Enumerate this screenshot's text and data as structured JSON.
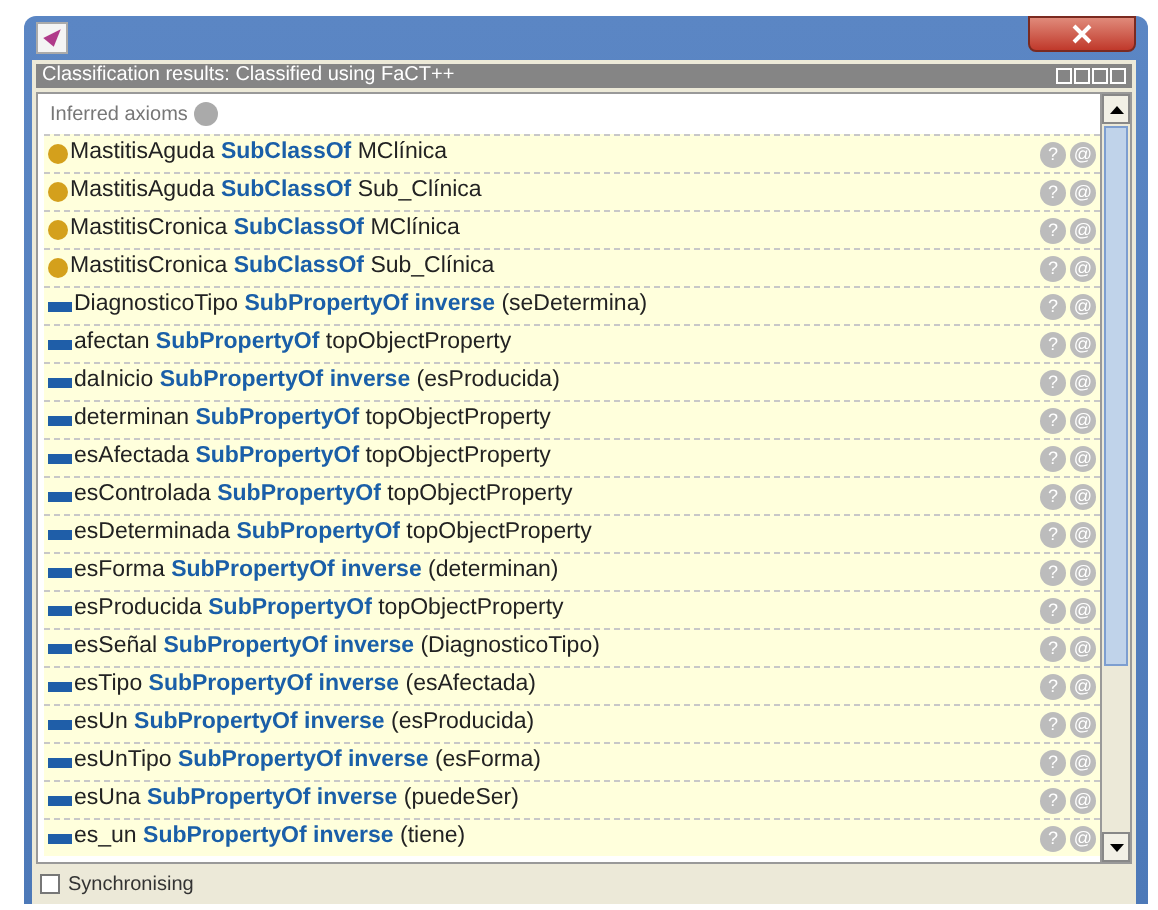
{
  "panel": {
    "title": "Classification results: Classified using FaCT++"
  },
  "section": {
    "label": "Inferred axioms"
  },
  "axioms": [
    {
      "kind": "class",
      "text": "MastitisAguda **SubClassOf** MClínica"
    },
    {
      "kind": "class",
      "text": "MastitisAguda **SubClassOf** Sub_Clínica"
    },
    {
      "kind": "class",
      "text": "MastitisCronica **SubClassOf** MClínica"
    },
    {
      "kind": "class",
      "text": "MastitisCronica **SubClassOf** Sub_Clínica"
    },
    {
      "kind": "property",
      "text": "DiagnosticoTipo **SubPropertyOf  inverse** (seDetermina)"
    },
    {
      "kind": "property",
      "text": "afectan **SubPropertyOf** topObjectProperty"
    },
    {
      "kind": "property",
      "text": "daInicio **SubPropertyOf  inverse** (esProducida)"
    },
    {
      "kind": "property",
      "text": "determinan **SubPropertyOf** topObjectProperty"
    },
    {
      "kind": "property",
      "text": "esAfectada **SubPropertyOf** topObjectProperty"
    },
    {
      "kind": "property",
      "text": "esControlada **SubPropertyOf** topObjectProperty"
    },
    {
      "kind": "property",
      "text": "esDeterminada **SubPropertyOf** topObjectProperty"
    },
    {
      "kind": "property",
      "text": "esForma **SubPropertyOf  inverse** (determinan)"
    },
    {
      "kind": "property",
      "text": "esProducida **SubPropertyOf** topObjectProperty"
    },
    {
      "kind": "property",
      "text": "esSeñal **SubPropertyOf  inverse** (DiagnosticoTipo)"
    },
    {
      "kind": "property",
      "text": "esTipo **SubPropertyOf  inverse** (esAfectada)"
    },
    {
      "kind": "property",
      "text": "esUn **SubPropertyOf  inverse** (esProducida)"
    },
    {
      "kind": "property",
      "text": "esUnTipo **SubPropertyOf  inverse** (esForma)"
    },
    {
      "kind": "property",
      "text": "esUna **SubPropertyOf  inverse** (puedeSer)"
    },
    {
      "kind": "property",
      "text": "es_un **SubPropertyOf  inverse** (tiene)"
    }
  ],
  "row_buttons": [
    "?",
    "@"
  ],
  "footer": {
    "label": "Synchronising",
    "checked": false
  }
}
